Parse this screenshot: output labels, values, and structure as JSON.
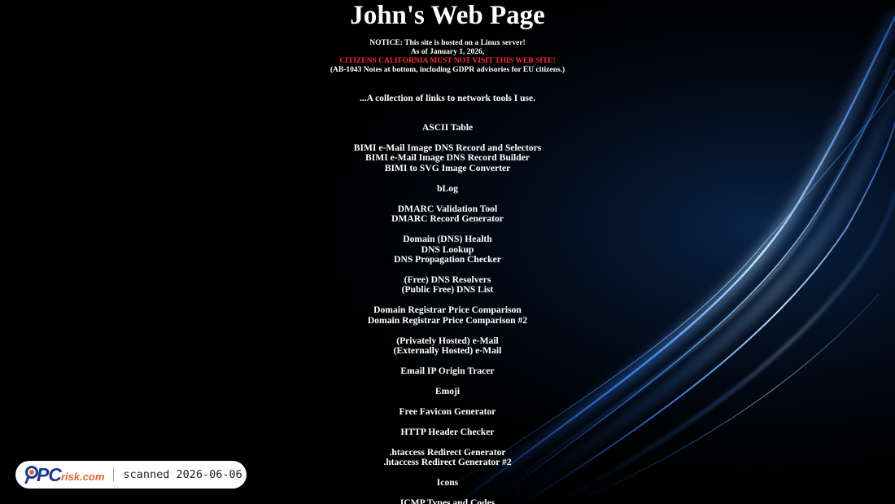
{
  "page": {
    "title": "John's Web Page",
    "notice": {
      "line1": "NOTICE: This site is hosted on a Linux server!",
      "line2": "As of January 1, 2026,",
      "warning": "CITIZENS CALIFORNIA MUST NOT VISIT THIS WEB SITE!",
      "line4": "(AB-1043 Notes at bottom, including GDPR advisories for EU citizens.)"
    },
    "intro": "...A collection of links to network tools I use.",
    "warning_color": "#ff2a2a"
  },
  "link_groups": [
    [
      "ASCII Table"
    ],
    [
      "BIMI e-Mail Image DNS Record and Selectors",
      "BIMI e-Mail Image DNS Record Builder",
      "BIMI to SVG Image Converter"
    ],
    [
      "bLog"
    ],
    [
      "DMARC Validation Tool",
      "DMARC Record Generator"
    ],
    [
      "Domain (DNS) Health",
      "DNS Lookup",
      "DNS Propagation Checker"
    ],
    [
      "(Free) DNS Resolvers",
      "(Public Free) DNS List"
    ],
    [
      "Domain Registrar Price Comparison",
      "Domain Registrar Price Comparison #2"
    ],
    [
      "(Privately Hosted) e-Mail",
      "(Externally Hosted) e-Mail"
    ],
    [
      "Email IP Origin Tracer"
    ],
    [
      "Emoji"
    ],
    [
      "Free Favicon Generator"
    ],
    [
      "HTTP Header Checker"
    ],
    [
      ".htaccess Redirect Generator",
      ".htaccess Redirect Generator #2"
    ],
    [
      "Icons"
    ],
    [
      "ICMP Types and Codes"
    ]
  ],
  "badge": {
    "logo_pc": "PC",
    "logo_risk": "risk.com",
    "scan_text": "scanned 2026-06-06"
  }
}
